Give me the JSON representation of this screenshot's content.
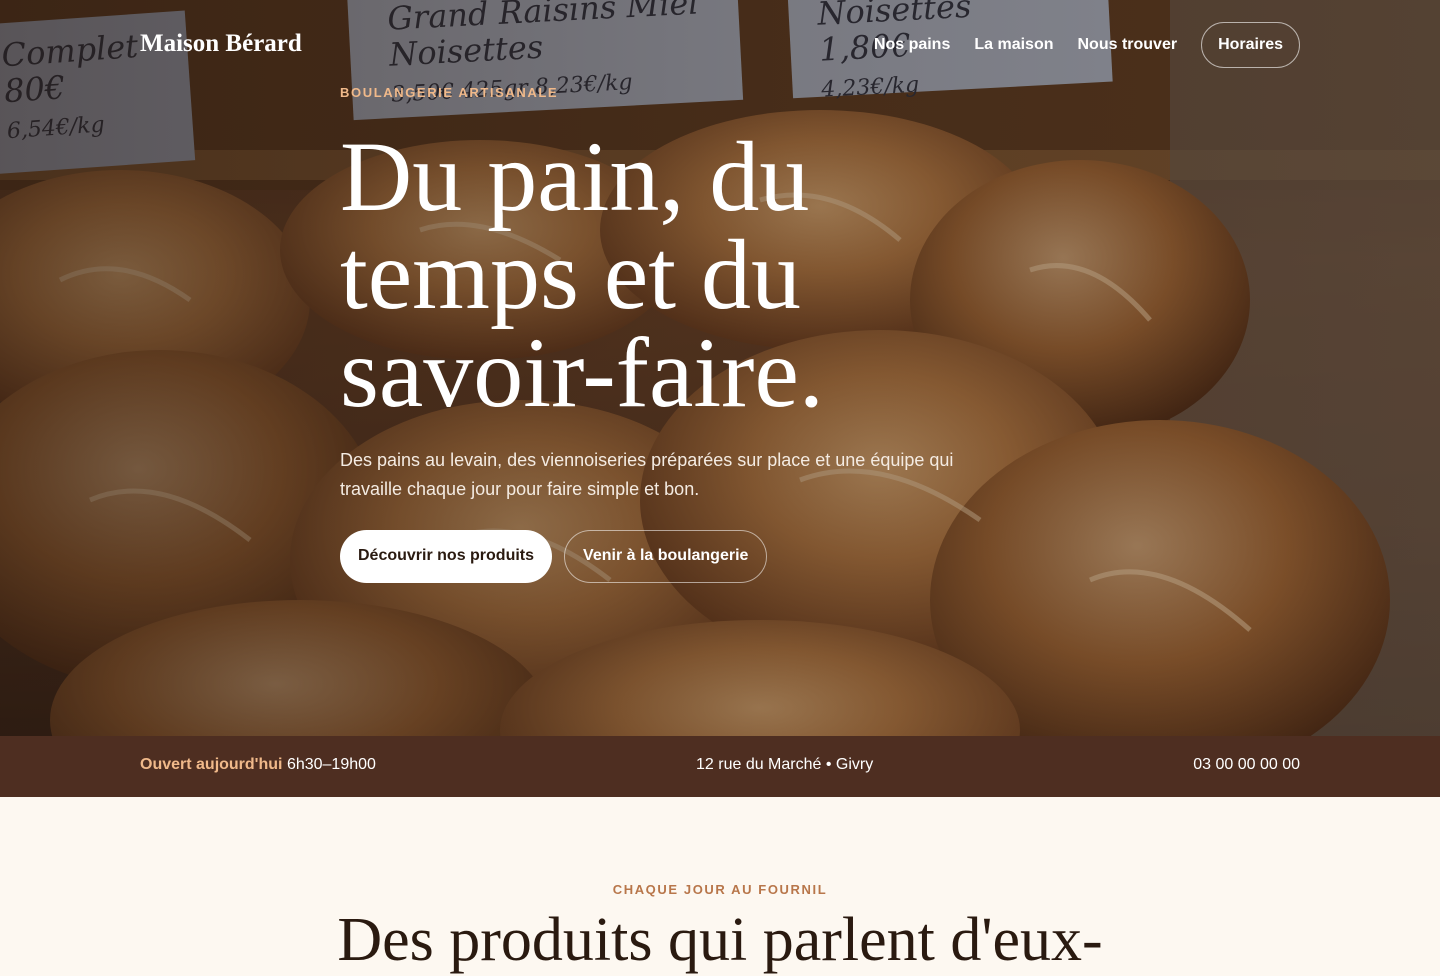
{
  "nav": {
    "brand": "Maison Bérard",
    "links": [
      "Nos pains",
      "La maison",
      "Nous trouver"
    ],
    "cta": "Horaires"
  },
  "hero": {
    "eyebrow": "BOULANGERIE ARTISANALE",
    "headline": "Du pain, du temps et du savoir-faire.",
    "lead": "Des pains au levain, des viennoiseries préparées sur place et une équipe qui travaille chaque jour pour faire simple et bon.",
    "primary_button": "Découvrir nos produits",
    "secondary_button": "Venir à la boulangerie",
    "price_tags": [
      {
        "line1": "Complet",
        "line2": "80€",
        "line3": "6,54€/kg"
      },
      {
        "line1": "Grand Raisins Miel",
        "line2": "Noisettes",
        "line3": "3,50€ 425gr 8,23€/kg"
      },
      {
        "line1": "Noisettes",
        "line2": "1,80€",
        "line3": "4,23€/kg"
      }
    ]
  },
  "infobar": {
    "open_label": "Ouvert aujourd'hui",
    "hours": "6h30–19h00",
    "address": "12 rue du Marché • Givry",
    "phone": "03 00 00 00 00"
  },
  "section": {
    "eyebrow": "CHAQUE JOUR AU FOURNIL",
    "title": "Des produits qui parlent d'eux-"
  },
  "colors": {
    "accent": "#f0b98a",
    "infobar_bg": "#4e2e21",
    "page_bg": "#fdf8f1",
    "section_eyebrow": "#b8764a"
  }
}
